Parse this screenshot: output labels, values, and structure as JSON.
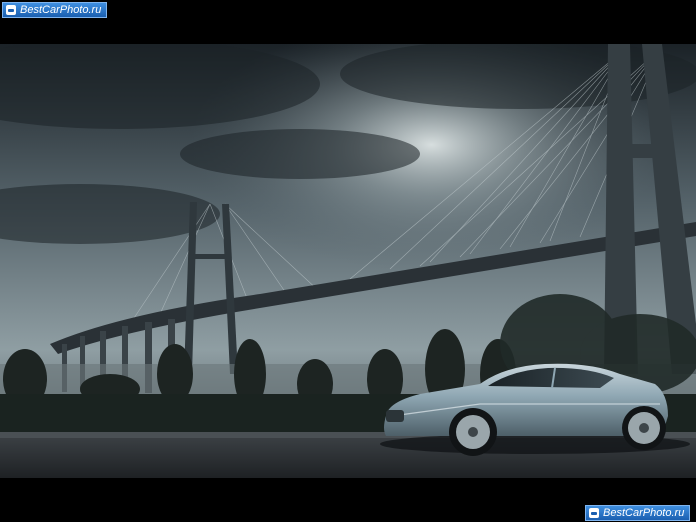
{
  "watermark": {
    "top_text": "BestCarPhoto.ru",
    "bottom_text": "BestCarPhoto.ru",
    "icon": "camera-icon"
  },
  "colors": {
    "letterbox": "#000000",
    "sky_top": "#1b2227",
    "sky_glow": "#d7dfe0",
    "road": "#2b2f33",
    "grass": "#1a2320",
    "car_body": "#8fa7b3",
    "watermark_bg": "#2a73c8"
  }
}
